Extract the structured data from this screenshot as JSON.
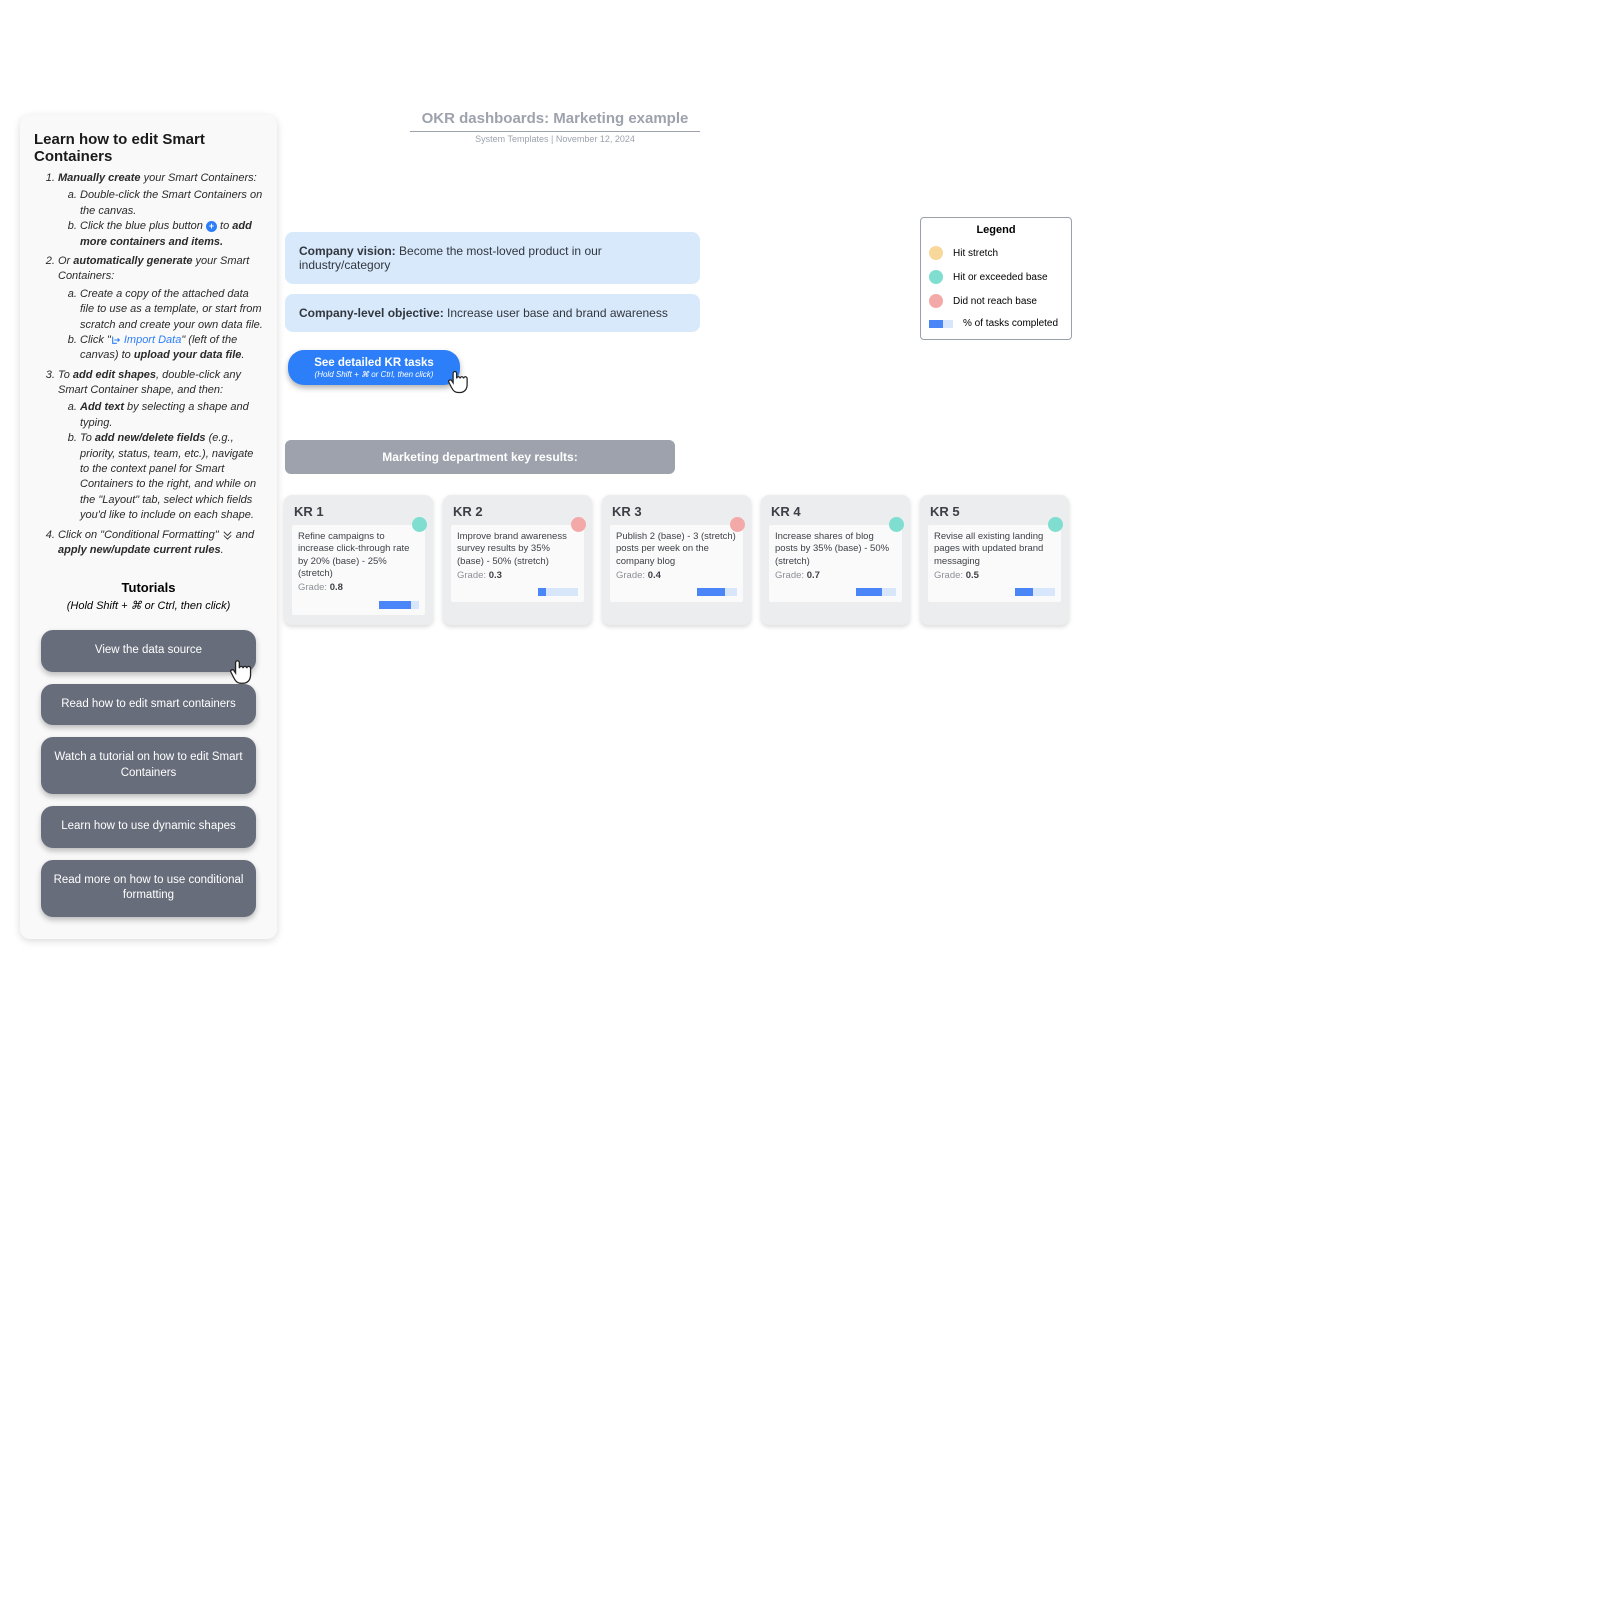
{
  "help": {
    "title": "Learn how to edit Smart Containers",
    "step1_lead_bold": "Manually create",
    "step1_lead_text": " your Smart Containers:",
    "step1a": "Double-click the Smart Containers on the canvas.",
    "step1b_pre": "Click the blue plus button ",
    "step1b_post": " to ",
    "step1b_bold": "add more containers and items.",
    "step2_pre": "Or ",
    "step2_bold": "automatically generate",
    "step2_post": " your Smart Containers:",
    "step2a": "Create a copy of the attached data file to use as a template, or start from scratch and create your own data file.",
    "step2b_pre": "Click \"",
    "step2b_link": " Import Data",
    "step2b_mid": "\" (left of the canvas) to ",
    "step2b_bold": "upload your data file",
    "step2b_end": ".",
    "step3_pre": "To ",
    "step3_bold": "add edit shapes",
    "step3_post": ", double-click any Smart Container shape, and then:",
    "step3a_bold": "Add text",
    "step3a_post": " by selecting a shape and typing.",
    "step3b_pre": "To ",
    "step3b_bold": "add new/delete fields",
    "step3b_post": " (e.g., priority, status, team, etc.), navigate to the context panel for Smart Containers to the right, and while on the \"Layout\" tab, select which fields you'd like to include on each shape.",
    "step4_pre": "Click on \"Conditional Formatting\" ",
    "step4_mid": " and ",
    "step4_bold": "apply new/update current rules",
    "step4_end": ".",
    "tutorials_header": "Tutorials",
    "tutorials_sub": "(Hold Shift + ⌘ or Ctrl, then click)",
    "buttons": [
      "View the data source",
      "Read how to edit smart containers",
      "Watch a tutorial on how to edit Smart Containers",
      "Learn how to use dynamic shapes",
      "Read more on how to use conditional formatting"
    ]
  },
  "doc": {
    "title": "OKR dashboards: Marketing example",
    "sub": "System Templates   |   November 12, 2024"
  },
  "vision": {
    "label": "Company vision: ",
    "text": "Become the most-loved product in our industry/category"
  },
  "objective": {
    "label": "Company-level objective: ",
    "text": "Increase user base and brand awareness"
  },
  "detail_btn": {
    "main": "See detailed KR tasks",
    "sub": "(Hold Shift + ⌘ or Ctrl, then click)"
  },
  "dept_header": "Marketing department key results:",
  "legend": {
    "title": "Legend",
    "items": [
      {
        "color": "#f8d79b",
        "label": "Hit stretch"
      },
      {
        "color": "#7fded0",
        "label": "Hit or exceeded base"
      },
      {
        "color": "#f4a9a9",
        "label": "Did not reach base"
      }
    ],
    "bar_label": "% of tasks completed"
  },
  "colors": {
    "hit_stretch": "#f8d79b",
    "hit_base": "#7fded0",
    "miss_base": "#f4a9a9"
  },
  "key_results": [
    {
      "id": "KR 1",
      "desc": "Refine campaigns to increase click-through rate by 20% (base) - 25% (stretch)",
      "grade": "0.8",
      "status": "hit_base",
      "progress": 0.8
    },
    {
      "id": "KR 2",
      "desc": "Improve brand awareness survey results by 35% (base) - 50% (stretch)",
      "grade": "0.3",
      "status": "miss_base",
      "progress": 0.2
    },
    {
      "id": "KR 3",
      "desc": "Publish 2 (base) - 3 (stretch) posts per week on the company blog",
      "grade": "0.4",
      "status": "miss_base",
      "progress": 0.7
    },
    {
      "id": "KR 4",
      "desc": "Increase shares of blog posts by 35% (base) - 50% (stretch)",
      "grade": "0.7",
      "status": "hit_base",
      "progress": 0.65
    },
    {
      "id": "KR 5",
      "desc": "Revise all existing landing pages with updated brand messaging",
      "grade": "0.5",
      "status": "hit_base",
      "progress": 0.45
    }
  ],
  "grade_label": "Grade: "
}
